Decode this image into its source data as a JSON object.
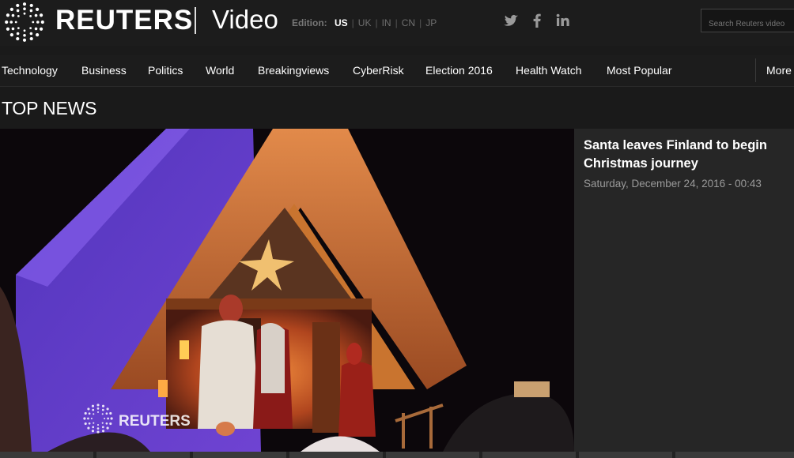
{
  "header": {
    "brand": "REUTERS",
    "section": "Video",
    "edition_label": "Edition:",
    "editions": [
      {
        "code": "US",
        "active": true
      },
      {
        "code": "UK",
        "active": false
      },
      {
        "code": "IN",
        "active": false
      },
      {
        "code": "CN",
        "active": false
      },
      {
        "code": "JP",
        "active": false
      }
    ],
    "social": [
      "twitter-icon",
      "facebook-icon",
      "linkedin-icon"
    ],
    "search_placeholder": "Search Reuters video"
  },
  "nav": {
    "items": [
      "Technology",
      "Business",
      "Politics",
      "World",
      "Breakingviews",
      "CyberRisk",
      "Election 2016",
      "Health Watch",
      "Most Popular"
    ],
    "more": "More"
  },
  "section_title": "TOP NEWS",
  "top_story": {
    "headline": "Santa leaves Finland to begin Christmas journey",
    "timestamp": "Saturday, December 24, 2016 - 00:43",
    "watermark": "REUTERS"
  },
  "colors": {
    "background": "#1a1a1a",
    "sidebar": "#262626",
    "text": "#ffffff",
    "muted": "#9a9a9a"
  }
}
